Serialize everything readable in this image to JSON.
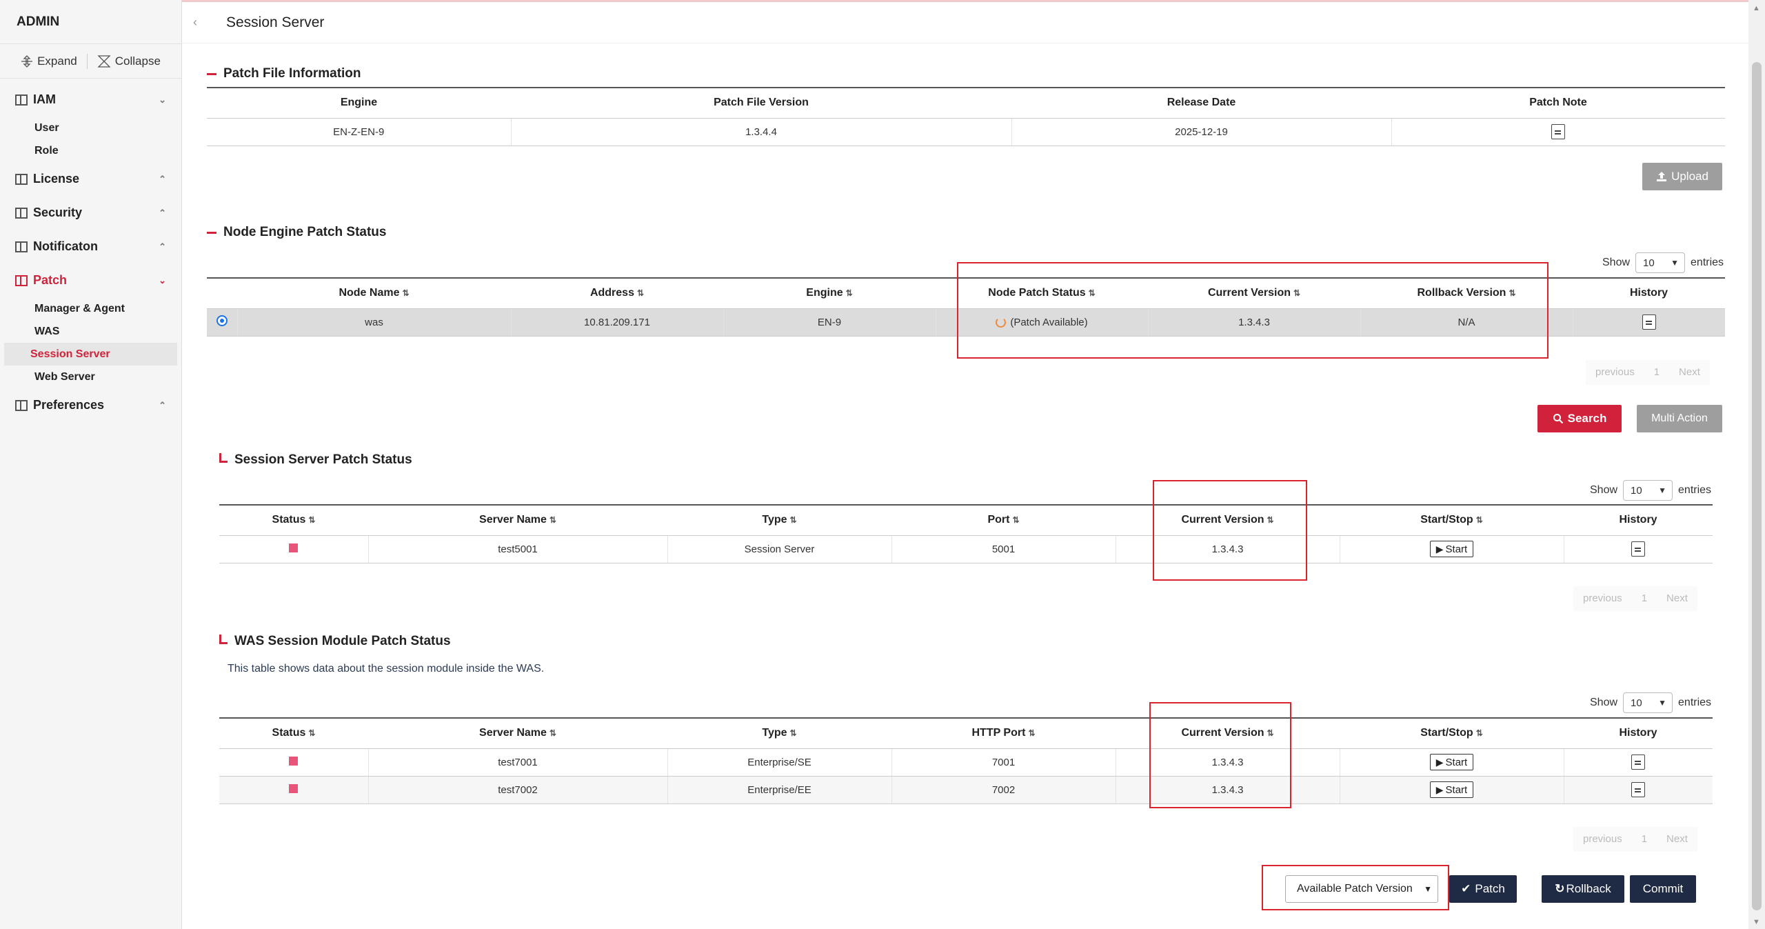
{
  "sidebar": {
    "title": "ADMIN",
    "expand_label": "Expand",
    "collapse_label": "Collapse",
    "groups": [
      {
        "label": "IAM",
        "chevron": "⌄",
        "items": [
          "User",
          "Role"
        ]
      },
      {
        "label": "License",
        "chevron": "⌃"
      },
      {
        "label": "Security",
        "chevron": "⌃"
      },
      {
        "label": "Notificaton",
        "chevron": "⌃"
      },
      {
        "label": "Patch",
        "chevron": "⌄",
        "items": [
          "Manager & Agent",
          "WAS",
          "Session Server",
          "Web Server"
        ]
      },
      {
        "label": "Preferences",
        "chevron": "⌃"
      }
    ],
    "selected_item": "Session Server"
  },
  "header": {
    "title": "Session Server"
  },
  "patch_file": {
    "title": "Patch File Information",
    "columns": [
      "Engine",
      "Patch File Version",
      "Release Date",
      "Patch Note"
    ],
    "row": {
      "engine": "EN-Z-EN-9",
      "version": "1.3.4.4",
      "release_date": "2025-12-19"
    },
    "upload_label": "Upload"
  },
  "node_status": {
    "title": "Node Engine Patch Status",
    "show_label": "Show",
    "entries_label": "entries",
    "page_size": "10",
    "columns": [
      "Node Name",
      "Address",
      "Engine",
      "Node Patch Status",
      "Current Version",
      "Rollback Version",
      "History"
    ],
    "row": {
      "node_name": "was",
      "address": "10.81.209.171",
      "engine": "EN-9",
      "patch_status": "(Patch Available)",
      "current_version": "1.3.4.3",
      "rollback_version": "N/A"
    },
    "pager": {
      "previous": "previous",
      "page": "1",
      "next": "Next"
    },
    "search_label": "Search",
    "multi_action_label": "Multi Action"
  },
  "session_server": {
    "title": "Session Server Patch Status",
    "show_label": "Show",
    "entries_label": "entries",
    "page_size": "10",
    "columns": [
      "Status",
      "Server Name",
      "Type",
      "Port",
      "Current Version",
      "Start/Stop",
      "History"
    ],
    "rows": [
      {
        "server_name": "test5001",
        "type": "Session Server",
        "port": "5001",
        "current_version": "1.3.4.3",
        "action": "Start"
      }
    ],
    "pager": {
      "previous": "previous",
      "page": "1",
      "next": "Next"
    }
  },
  "was_module": {
    "title": "WAS Session Module Patch Status",
    "description": "This table shows data about the session module inside the WAS.",
    "show_label": "Show",
    "entries_label": "entries",
    "page_size": "10",
    "columns": [
      "Status",
      "Server Name",
      "Type",
      "HTTP Port",
      "Current Version",
      "Start/Stop",
      "History"
    ],
    "rows": [
      {
        "server_name": "test7001",
        "type": "Enterprise/SE",
        "port": "7001",
        "current_version": "1.3.4.3",
        "action": "Start"
      },
      {
        "server_name": "test7002",
        "type": "Enterprise/EE",
        "port": "7002",
        "current_version": "1.3.4.3",
        "action": "Start"
      }
    ],
    "pager": {
      "previous": "previous",
      "page": "1",
      "next": "Next"
    }
  },
  "footer_actions": {
    "patch_version_select": "Available Patch Version",
    "patch_label": "Patch",
    "rollback_label": "Rollback",
    "commit_label": "Commit"
  },
  "colors": {
    "accent": "#d0233b",
    "navy": "#1f2a44",
    "status": "#e8547a",
    "highlight_box": "#d9232e"
  }
}
